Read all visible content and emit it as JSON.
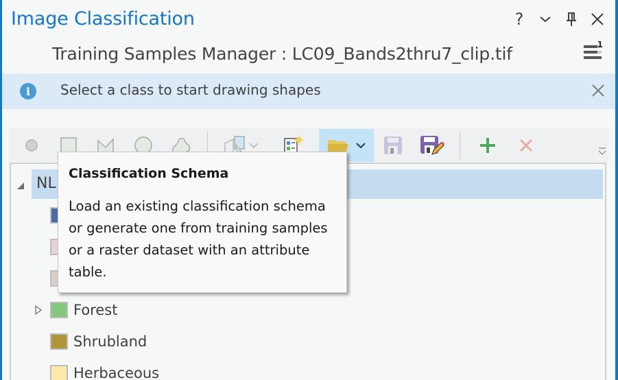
{
  "pane": {
    "title": "Image Classification",
    "subtitle": "Training Samples Manager : LC09_Bands2thru7_clip.tif",
    "controls": {
      "help": "?",
      "options": "chevron-down",
      "pin": "pin",
      "close": "close"
    },
    "menu_badge": "1"
  },
  "banner": {
    "text": "Select a class to start drawing shapes",
    "icon": "info-icon"
  },
  "toolbar": {
    "tools": [
      {
        "name": "point",
        "enabled": false
      },
      {
        "name": "rectangle",
        "enabled": false
      },
      {
        "name": "polygon",
        "enabled": false
      },
      {
        "name": "circle",
        "enabled": false
      },
      {
        "name": "freehand",
        "enabled": false
      },
      {
        "name": "select-segment",
        "enabled": false
      },
      {
        "name": "create-new-schema",
        "enabled": true
      },
      {
        "name": "load-schema",
        "enabled": true,
        "active": true
      },
      {
        "name": "save-schema",
        "enabled": false
      },
      {
        "name": "save-schema-as",
        "enabled": true
      },
      {
        "name": "add-class",
        "enabled": true
      },
      {
        "name": "remove-class",
        "enabled": false
      }
    ]
  },
  "tree": {
    "root_label": "NL",
    "items": [
      {
        "label": "",
        "color": "#4a6aa8",
        "expandable": false
      },
      {
        "label": "",
        "color": "#e8d2d2",
        "expandable": false
      },
      {
        "label": "",
        "color": "#d8d0c8",
        "expandable": false
      },
      {
        "label": "Forest",
        "color": "#85c77e",
        "expandable": true
      },
      {
        "label": "Shrubland",
        "color": "#af963c",
        "expandable": false
      },
      {
        "label": "Herbaceous",
        "color": "#fde9aa",
        "expandable": false
      }
    ]
  },
  "tooltip": {
    "title": "Classification Schema",
    "body": "Load an existing classification schema or generate one from training samples or a raster dataset with an attribute table."
  }
}
